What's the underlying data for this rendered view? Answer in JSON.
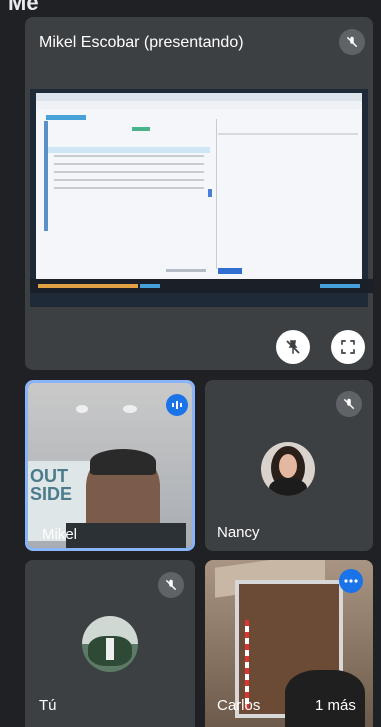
{
  "presenter": {
    "name": "Mikel Escobar (presentando)",
    "mic_icon": "mic-off-icon",
    "pin_icon": "pin-off-icon",
    "fullscreen_icon": "fullscreen-icon"
  },
  "participants": [
    {
      "name": "Mikel",
      "speaking": true,
      "highlight_color": "#8ab4f8"
    },
    {
      "name": "Nancy",
      "muted": true
    },
    {
      "name": "Tú",
      "muted": true
    },
    {
      "name": "Carlos",
      "more": "1 más"
    }
  ],
  "colors": {
    "accent": "#1a73e8",
    "tile": "#3c4043",
    "background": "#202124"
  }
}
